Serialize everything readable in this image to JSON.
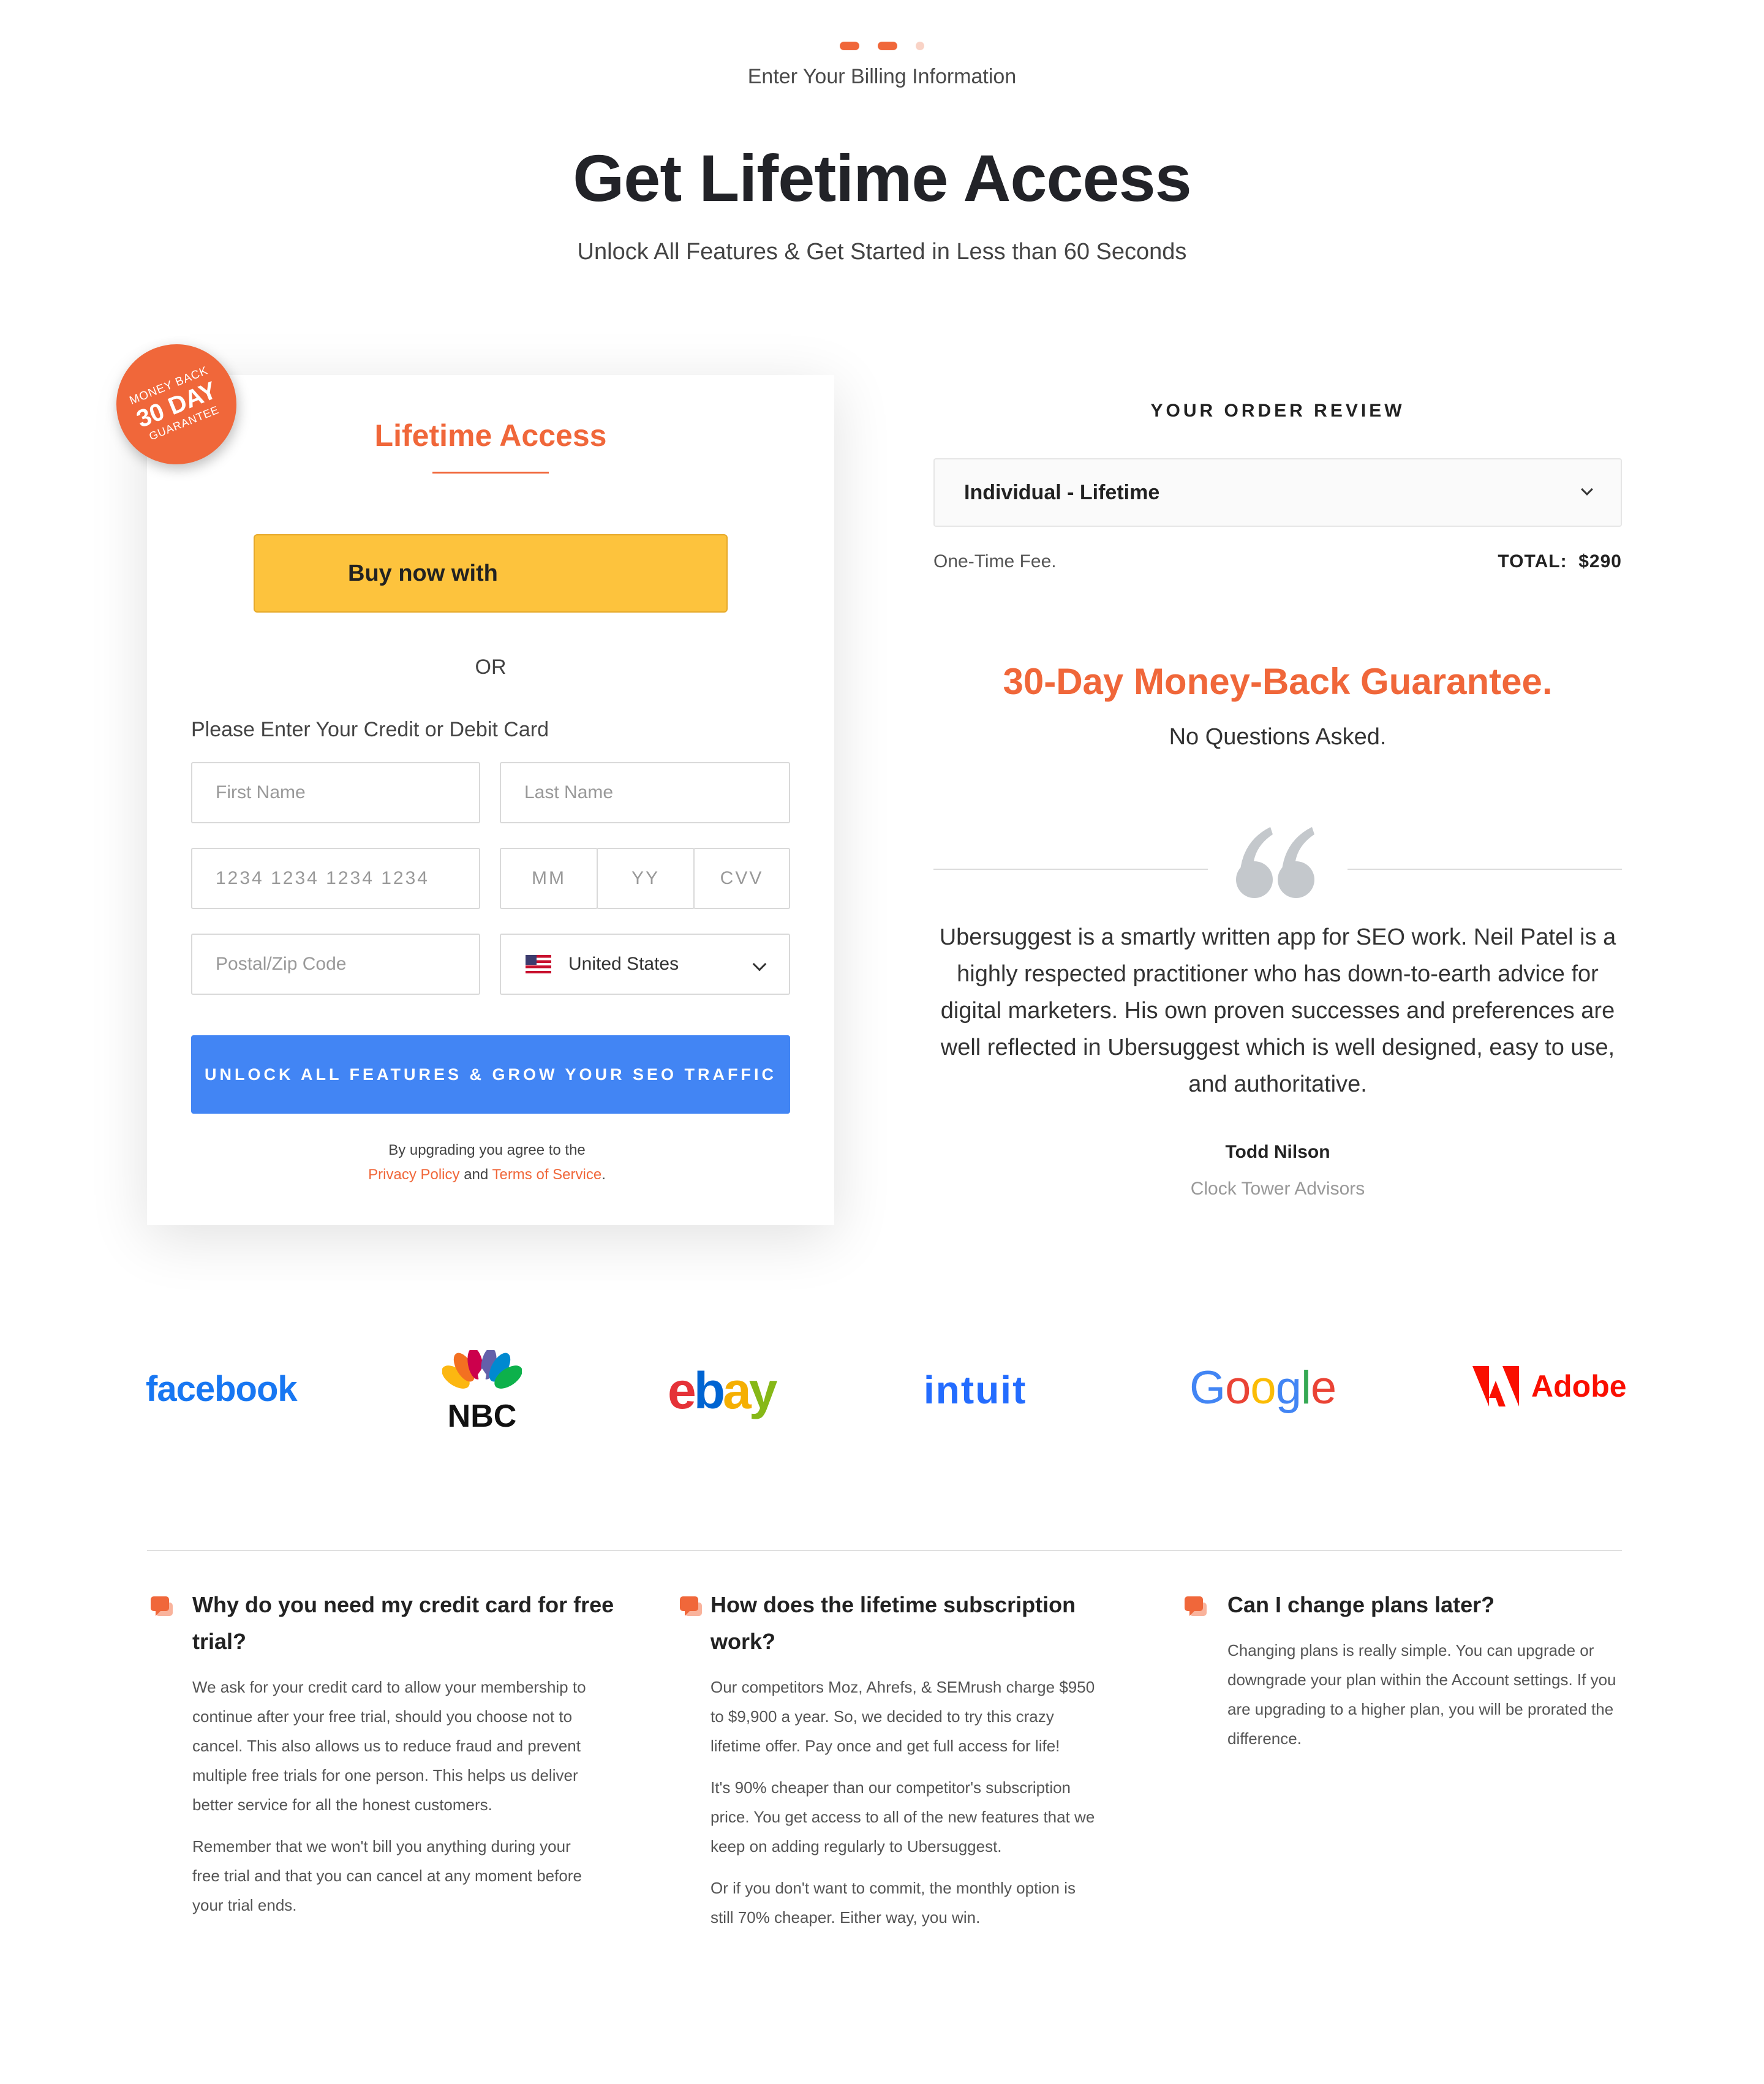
{
  "progress": {
    "label": "Enter Your Billing Information",
    "current_step": 2,
    "total_steps": 3
  },
  "hero": {
    "title": "Get Lifetime Access",
    "subtitle": "Unlock All Features & Get Started in Less than 60 Seconds"
  },
  "badge": {
    "line1": "MONEY BACK",
    "line2": "30 DAY",
    "line3": "GUARANTEE"
  },
  "card": {
    "title": "Lifetime Access",
    "paypal_label": "Buy now with",
    "or_text": "OR",
    "prompt": "Please Enter Your Credit or Debit Card",
    "fields": {
      "first_name": "First Name",
      "last_name": "Last Name",
      "card_number": "1234 1234 1234 1234",
      "mm": "MM",
      "yy": "YY",
      "cvv": "CVV",
      "postal": "Postal/Zip Code",
      "country": "United States"
    },
    "cta": "UNLOCK ALL FEATURES & GROW YOUR SEO TRAFFIC",
    "legal_prefix": "By upgrading you agree to the",
    "privacy_link": "Privacy Policy",
    "legal_and": "and",
    "terms_link": "Terms of Service",
    "legal_suffix": "."
  },
  "order": {
    "heading": "YOUR ORDER REVIEW",
    "selected_plan": "Individual - Lifetime",
    "fee_label": "One-Time Fee.",
    "total_label": "TOTAL:",
    "total_value": "$290"
  },
  "guarantee": {
    "title": "30-Day Money-Back Guarantee.",
    "subtitle": "No Questions Asked."
  },
  "testimonial": {
    "text": "Ubersuggest is a smartly written app for SEO work. Neil Patel is a highly respected practitioner who has down-to-earth advice for digital marketers. His own proven successes and preferences are well reflected in Ubersuggest which is well designed, easy to use, and authoritative.",
    "author": "Todd Nilson",
    "company": "Clock Tower Advisors"
  },
  "logos": {
    "facebook": "facebook",
    "nbc": "NBC",
    "ebay": [
      "e",
      "b",
      "a",
      "y"
    ],
    "intuit": "intuit",
    "google": [
      "G",
      "o",
      "o",
      "g",
      "l",
      "e"
    ],
    "adobe": "Adobe"
  },
  "faq": [
    {
      "question": "Why do you need my credit card for free trial?",
      "answers": [
        "We ask for your credit card to allow your membership to continue after your free trial, should you choose not to cancel. This also allows us to reduce fraud and prevent multiple free trials for one person. This helps us deliver better service for all the honest customers.",
        "Remember that we won't bill you anything during your free trial and that you can cancel at any moment before your trial ends."
      ]
    },
    {
      "question": "How does the lifetime subscription work?",
      "answers": [
        "Our competitors Moz, Ahrefs, & SEMrush charge $950 to $9,900 a year. So, we decided to try this crazy lifetime offer. Pay once and get full access for life!",
        "It's 90% cheaper than our competitor's subscription price. You get access to all of the new features that we keep on adding regularly to Ubersuggest.",
        "Or if you don't want to commit, the monthly option is still 70% cheaper. Either way, you win."
      ]
    },
    {
      "question": "Can I change plans later?",
      "answers": [
        "Changing plans is really simple. You can upgrade or downgrade your plan within the Account settings. If you are upgrading to a higher plan, you will be prorated the difference."
      ]
    }
  ],
  "colors": {
    "accent": "#f0673a",
    "cta_blue": "#4285f4",
    "paypal_yellow": "#fdc33d",
    "heading": "#222328"
  }
}
